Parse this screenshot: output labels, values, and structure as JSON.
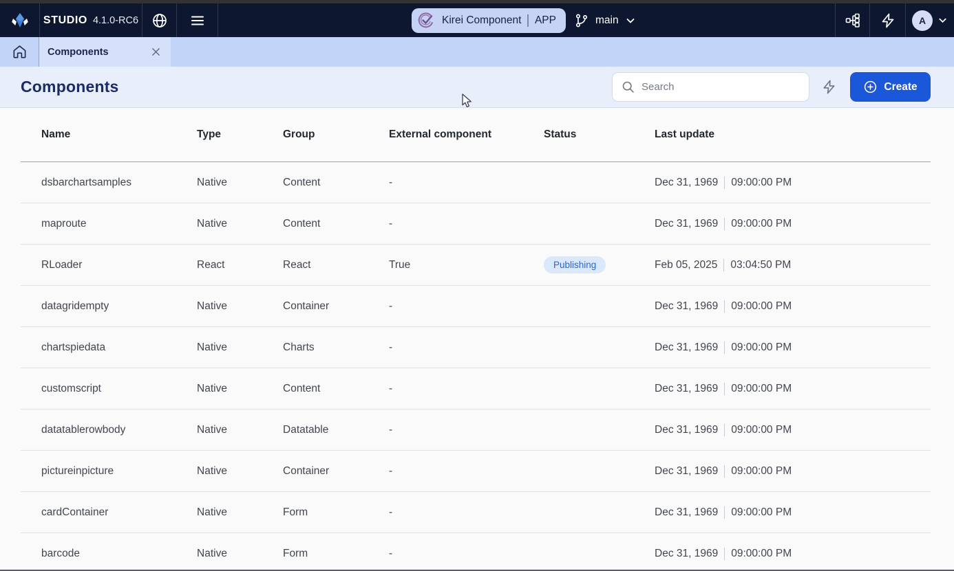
{
  "topbar": {
    "product": "STUDIO",
    "version": "4.1.0-RC6",
    "app_pill": {
      "name": "Kirei Component",
      "tag": "APP"
    },
    "branch": "main",
    "avatar_letter": "A"
  },
  "tabbar": {
    "active_tab": "Components"
  },
  "header": {
    "title": "Components",
    "search_placeholder": "Search",
    "create_label": "Create"
  },
  "table": {
    "columns": [
      "Name",
      "Type",
      "Group",
      "External component",
      "Status",
      "Last update"
    ],
    "rows": [
      {
        "name": "dsbarchartsamples",
        "type": "Native",
        "group": "Content",
        "external": "-",
        "status": "",
        "date": "Dec 31, 1969",
        "time": "09:00:00 PM"
      },
      {
        "name": "maproute",
        "type": "Native",
        "group": "Content",
        "external": "-",
        "status": "",
        "date": "Dec 31, 1969",
        "time": "09:00:00 PM"
      },
      {
        "name": "RLoader",
        "type": "React",
        "group": "React",
        "external": "True",
        "status": "Publishing",
        "date": "Feb 05, 2025",
        "time": "03:04:50 PM"
      },
      {
        "name": "datagridempty",
        "type": "Native",
        "group": "Container",
        "external": "-",
        "status": "",
        "date": "Dec 31, 1969",
        "time": "09:00:00 PM"
      },
      {
        "name": "chartspiedata",
        "type": "Native",
        "group": "Charts",
        "external": "-",
        "status": "",
        "date": "Dec 31, 1969",
        "time": "09:00:00 PM"
      },
      {
        "name": "customscript",
        "type": "Native",
        "group": "Content",
        "external": "-",
        "status": "",
        "date": "Dec 31, 1969",
        "time": "09:00:00 PM"
      },
      {
        "name": "datatablerowbody",
        "type": "Native",
        "group": "Datatable",
        "external": "-",
        "status": "",
        "date": "Dec 31, 1969",
        "time": "09:00:00 PM"
      },
      {
        "name": "pictureinpicture",
        "type": "Native",
        "group": "Container",
        "external": "-",
        "status": "",
        "date": "Dec 31, 1969",
        "time": "09:00:00 PM"
      },
      {
        "name": "cardContainer",
        "type": "Native",
        "group": "Form",
        "external": "-",
        "status": "",
        "date": "Dec 31, 1969",
        "time": "09:00:00 PM"
      },
      {
        "name": "barcode",
        "type": "Native",
        "group": "Form",
        "external": "-",
        "status": "",
        "date": "Dec 31, 1969",
        "time": "09:00:00 PM"
      }
    ]
  },
  "colors": {
    "navbar_bg": "#0D1830",
    "tabbar_bg": "#C2D4F8",
    "header_bg": "#E9EEFB",
    "accent_blue": "#1B57D9",
    "title_navy": "#1A2B6B",
    "badge_bg": "#DBE7FB",
    "badge_text": "#2B66CE",
    "pill_bg": "#C6D3F4"
  }
}
